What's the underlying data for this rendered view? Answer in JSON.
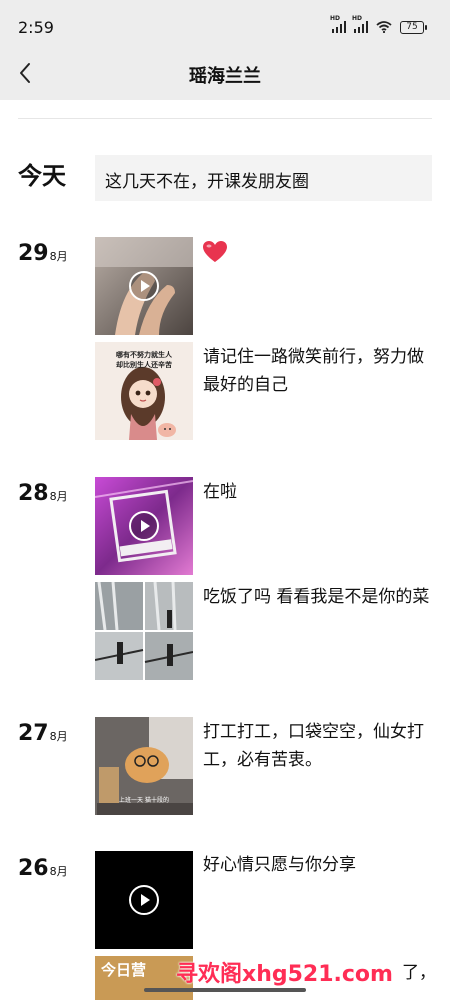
{
  "status": {
    "time": "2:59",
    "battery": "75",
    "signal_hd_1": "HD",
    "signal_hd_2": "HD"
  },
  "header": {
    "title": "瑶海兰兰"
  },
  "today": {
    "label": "今天",
    "text": "这几天不在，开课发朋友圈"
  },
  "days": [
    {
      "day": "29",
      "month": "8月"
    },
    {
      "day": "28",
      "month": "8月"
    },
    {
      "day": "27",
      "month": "8月"
    },
    {
      "day": "26",
      "month": "8月"
    }
  ],
  "posts": {
    "aug29_b_caption": "请记住一路微笑前行，努力做最好的自己",
    "aug29_b_image_text_line1": "哪有不努力就生人",
    "aug29_b_image_text_line2": "却比别生人还辛苦",
    "aug28_a_caption": "在啦",
    "aug28_b_caption": "吃饭了吗 看看我是不是你的菜",
    "aug27_caption": "打工打工，口袋空空，仙女打工，必有苦衷。",
    "aug27_image_text": "上班一天 猫十段的",
    "aug26_a_caption": "好心情只愿与你分享",
    "aug26_b_image_text": "今日营",
    "aug26_b_caption_tail": "了，"
  },
  "watermark": "寻欢阁xhg521.com",
  "colors": {
    "nav_bg": "#ededed",
    "text_post_bg": "#f3f3f3",
    "heart": "#e8344f",
    "watermark": "#ff2d55"
  }
}
